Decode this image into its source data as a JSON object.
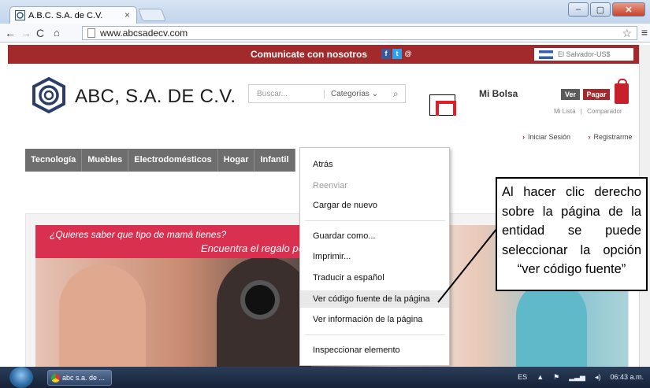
{
  "browser": {
    "tab_title": "A.B.C. S.A. de C.V.",
    "tab_close": "×",
    "url": "www.abcsadecv.com"
  },
  "site": {
    "contact_text": "Comunicate con nosotros",
    "social": [
      "f",
      "t",
      "@"
    ],
    "region": "El Salvador-US$",
    "brand": "ABC, S.A. DE C.V.",
    "search_placeholder": "Buscar...",
    "categories_label": "Categorías",
    "cart_label": "Mi Bolsa",
    "ver_label": "Ver",
    "pagar_label": "Pagar",
    "mi_lista": "Mi Lista",
    "comparador": "Comparador",
    "iniciar_sesion": "Iniciar Sesión",
    "registrarme": "Registrarme",
    "categories": [
      "Tecnología",
      "Muebles",
      "Electrodomésticos",
      "Hogar",
      "Infantil"
    ],
    "banner_line1": "¿Quieres saber que tipo de mamá tienes?",
    "banner_line2": "Encuentra el regalo pe"
  },
  "context_menu": {
    "items": [
      {
        "label": "Atrás",
        "disabled": false
      },
      {
        "label": "Reenviar",
        "disabled": true
      },
      {
        "label": "Cargar de nuevo",
        "disabled": false
      },
      {
        "label": "Guardar como...",
        "disabled": false
      },
      {
        "label": "Imprimir...",
        "disabled": false
      },
      {
        "label": "Traducir a español",
        "disabled": false
      },
      {
        "label": "Ver código fuente de la página",
        "disabled": false,
        "highlighted": true
      },
      {
        "label": "Ver información de la página",
        "disabled": false
      },
      {
        "label": "Inspeccionar elemento",
        "disabled": false
      }
    ]
  },
  "callout": {
    "text": "Al hacer clic derecho sobre la página de la entidad se puede seleccionar la opción “ver código fuente”"
  },
  "taskbar": {
    "task_label": "abc s.a. de ...",
    "lang": "ES",
    "clock": "06:43 a.m."
  }
}
